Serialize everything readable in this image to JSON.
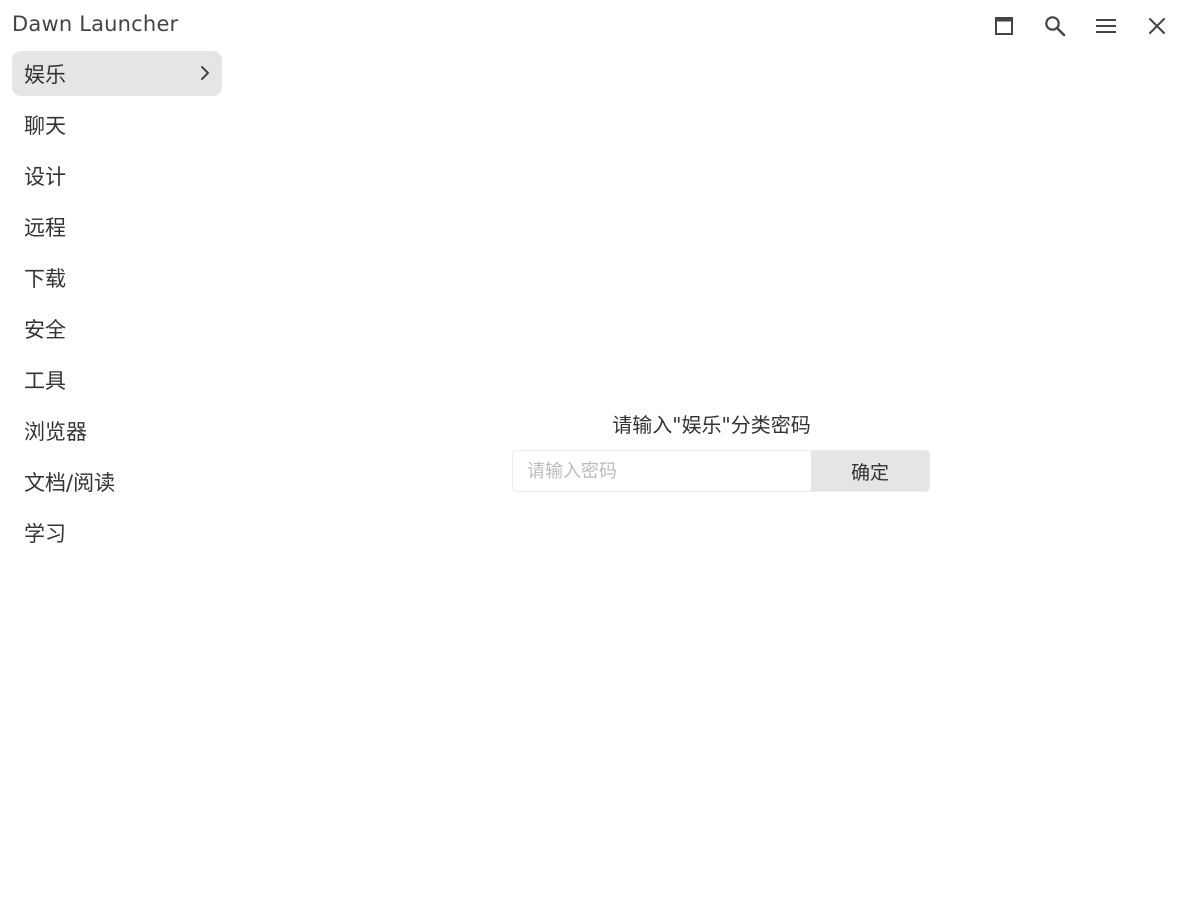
{
  "app": {
    "title": "Dawn Launcher"
  },
  "titlebar": {
    "buttons": [
      {
        "name": "maximize",
        "icon": "maximize-icon"
      },
      {
        "name": "search",
        "icon": "search-icon"
      },
      {
        "name": "menu",
        "icon": "hamburger-menu-icon"
      },
      {
        "name": "close",
        "icon": "close-icon"
      }
    ]
  },
  "sidebar": {
    "items": [
      {
        "label": "娱乐",
        "active": true
      },
      {
        "label": "聊天",
        "active": false
      },
      {
        "label": "设计",
        "active": false
      },
      {
        "label": "远程",
        "active": false
      },
      {
        "label": "下载",
        "active": false
      },
      {
        "label": "安全",
        "active": false
      },
      {
        "label": "工具",
        "active": false
      },
      {
        "label": "浏览器",
        "active": false
      },
      {
        "label": "文档/阅读",
        "active": false
      },
      {
        "label": "学习",
        "active": false
      }
    ]
  },
  "lock": {
    "prompt": "请输入\"娱乐\"分类密码",
    "input_value": "",
    "input_placeholder": "请输入密码",
    "confirm_label": "确定"
  },
  "colors": {
    "active_item_bg": "#e5e5e5",
    "text": "#333333",
    "confirm_bg": "#e5e5e5",
    "icon": "#444444"
  }
}
